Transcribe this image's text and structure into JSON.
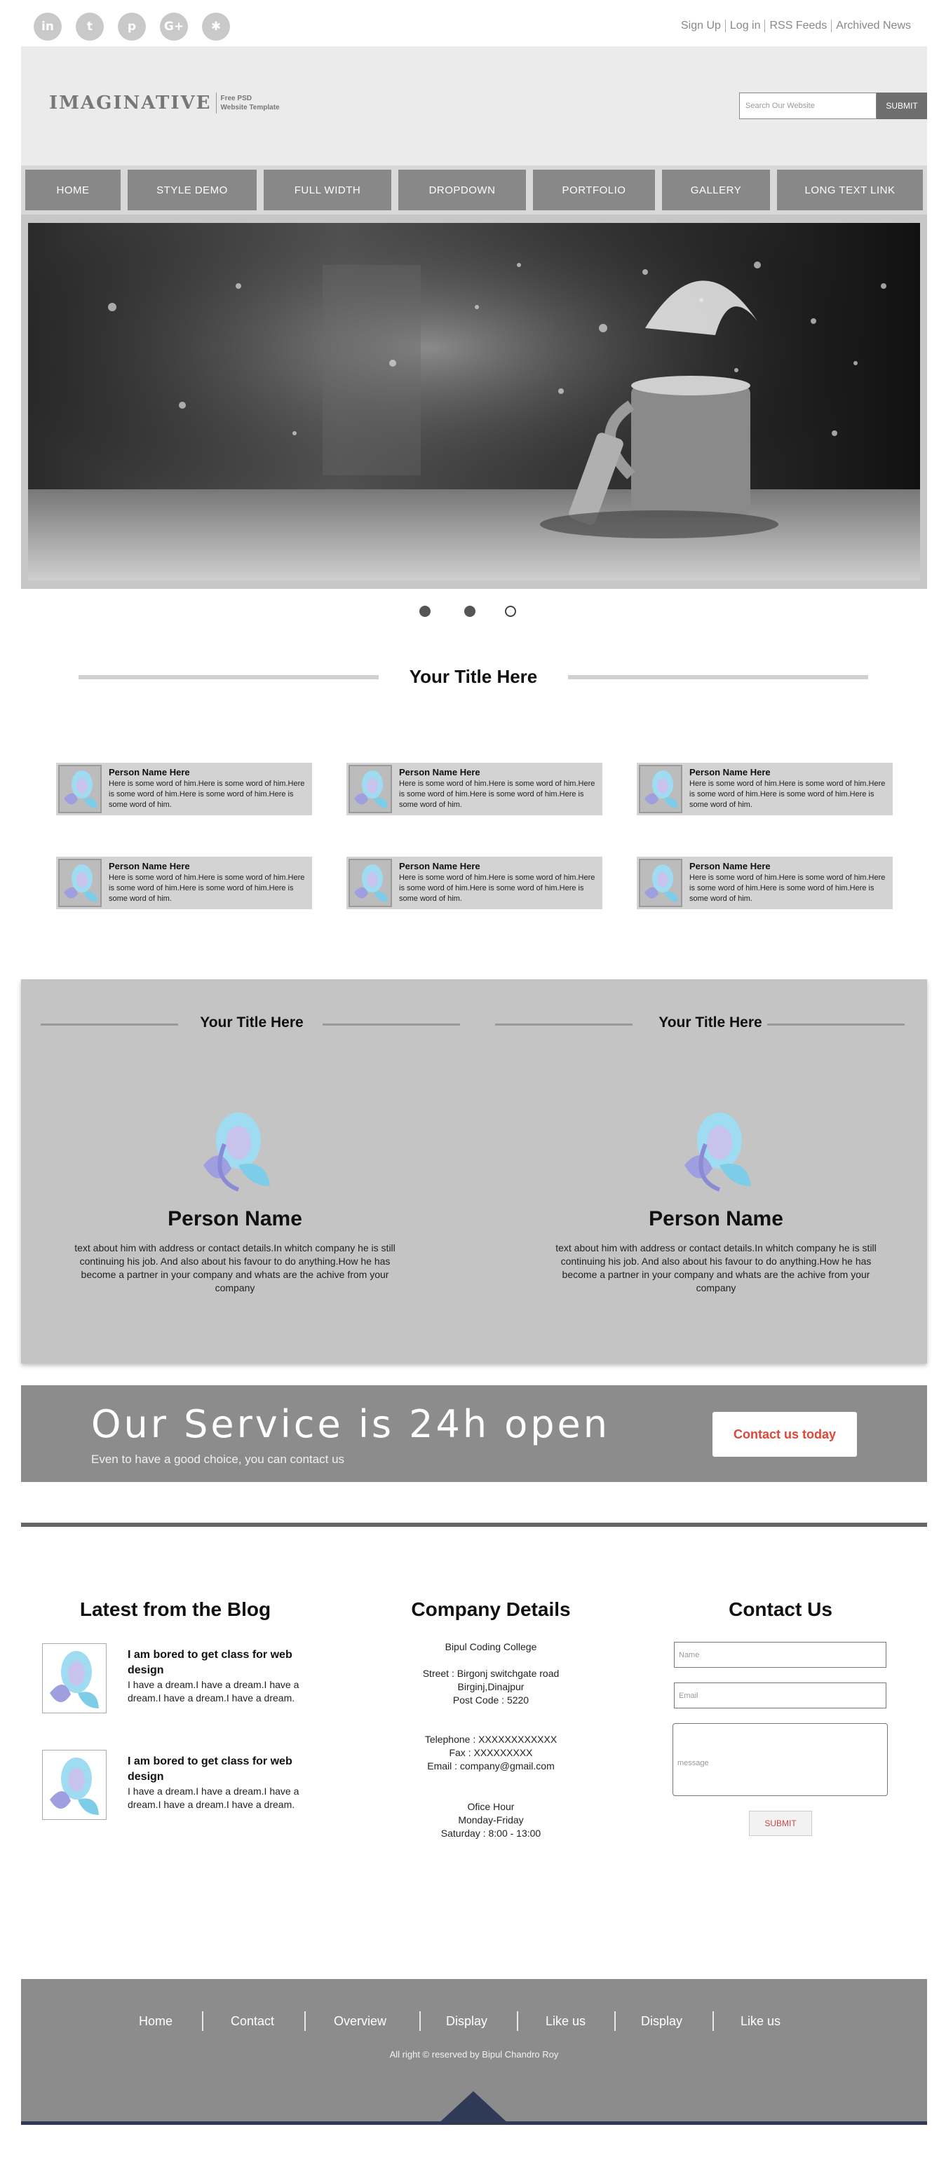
{
  "social": {
    "icons": [
      "linkedin-icon",
      "twitter-icon",
      "pinterest-icon",
      "google-plus-icon",
      "yelp-icon"
    ],
    "glyphs": [
      "in",
      "t",
      "p",
      "G+",
      "✱"
    ]
  },
  "top_links": [
    "Sign Up",
    "Log in",
    "RSS Feeds",
    "Archived News"
  ],
  "header": {
    "logo": "IMAGINATIVE",
    "logo_sub1": "Free PSD",
    "logo_sub2": "Website Template",
    "search_placeholder": "Search Our Website",
    "search_button": "SUBMIT"
  },
  "nav": [
    "HOME",
    "STYLE DEMO",
    "FULL WIDTH",
    "DROPDOWN",
    "PORTFOLIO",
    "GALLERY",
    "LONG TEXT LINK"
  ],
  "slider": {
    "dots": 3,
    "active_dot": 3
  },
  "team": {
    "title": "Your Title Here",
    "person_name": "Person Name Here",
    "person_text": "Here is some word of him.Here is some word of him.Here is some word of him.Here is some word of him.Here is some word of him."
  },
  "profiles": {
    "title": "Your Title Here",
    "name": "Person Name",
    "text": "text about him with address or contact details.In whitch company he is still continuing his job. And also about his favour to do anything.How he has become a partner in your company and whats are the achive from your company"
  },
  "service": {
    "headline": "Our Service is 24h open",
    "sub": "Even to have a good choice, you can contact us",
    "cta": "Contact us today"
  },
  "blog": {
    "title": "Latest from the Blog",
    "posts": [
      {
        "title": "I am bored to get class for web design",
        "text": "I have a dream.I have a dream.I have a dream.I have a dream.I have a dream."
      },
      {
        "title": "I am bored to get class for web design",
        "text": "I have a dream.I have a dream.I have a dream.I have a dream.I have a dream."
      }
    ]
  },
  "company": {
    "title": "Company Details",
    "name": "Bipul Coding College",
    "street": "Street : Birgonj switchgate road",
    "city": "Birginj,Dinajpur",
    "post": "Post Code : 5220",
    "phone": "Telephone : XXXXXXXXXXXX",
    "fax": "Fax : XXXXXXXXX",
    "email": "Email : company@gmail.com",
    "office": "Ofice Hour",
    "days": "Monday-Friday",
    "saturday": "Saturday : 8:00 - 13:00"
  },
  "contact": {
    "title": "Contact Us",
    "name_placeholder": "Name",
    "email_placeholder": "Email",
    "message_placeholder": "message",
    "submit": "SUBMIT"
  },
  "footer": {
    "links": [
      "Home",
      "Contact",
      "Overview",
      "Display",
      "Like us",
      "Display",
      "Like us"
    ],
    "copyright": "All right © reserved by Bipul Chandro Roy"
  },
  "colors": {
    "header_bg": "#ebebeb",
    "nav_item": "#888888",
    "panel": "#c4c4c4",
    "cta_text": "#e0453a",
    "footer_bar": "#2f3a57"
  }
}
